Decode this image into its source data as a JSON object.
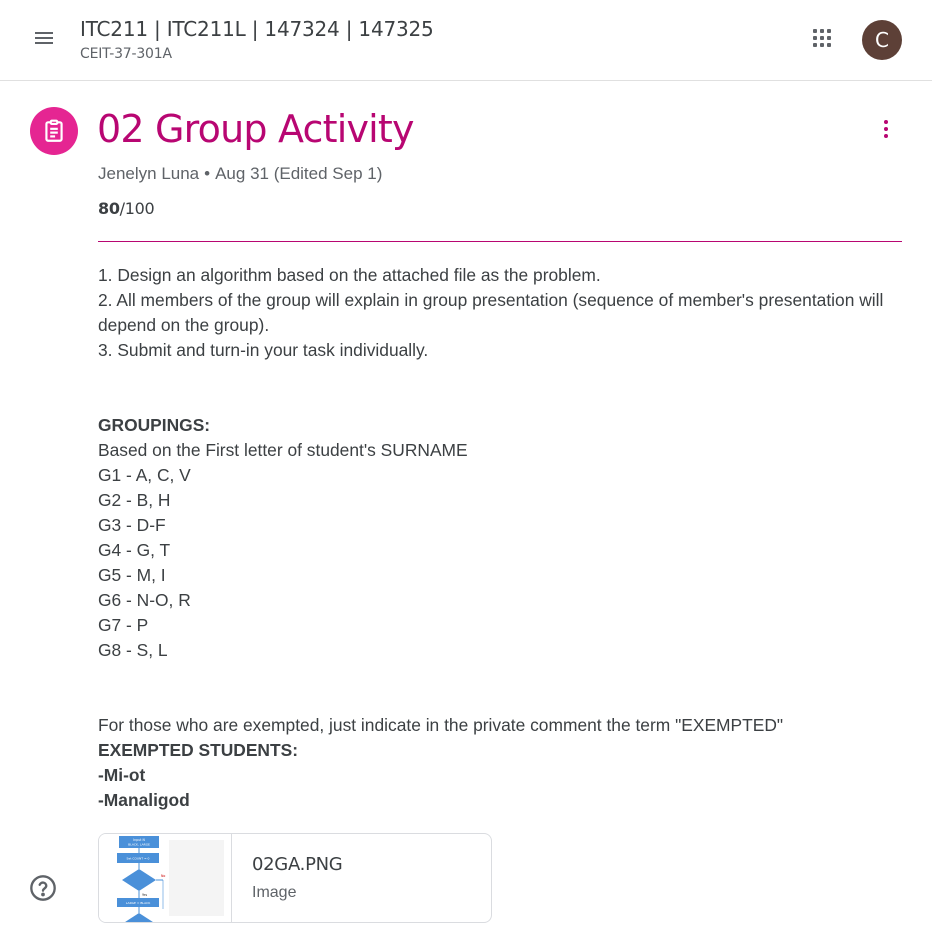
{
  "header": {
    "course_title": "ITC211 | ITC211L | 147324 | 147325",
    "course_section": "CEIT-37-301A",
    "avatar_letter": "C",
    "avatar_color": "#5d4037",
    "icons": {
      "menu": "hamburger-menu-icon",
      "apps": "apps-grid-icon"
    }
  },
  "assignment": {
    "title": "02 Group Activity",
    "author": "Jenelyn Luna",
    "separator": "•",
    "date": "Aug 31 (Edited Sep 1)",
    "score": "80",
    "total": "/100",
    "accent_color": "#b80672",
    "icon_color": "#e52592",
    "icons": {
      "type": "assignment-clipboard-icon",
      "more": "more-vert-icon"
    }
  },
  "instructions": {
    "step1": "1. Design an algorithm based on the attached file as the problem.",
    "step2": "2. All members of the group will explain in group presentation (sequence of member's presentation will depend on the group).",
    "step3": "3. Submit and turn-in your task individually.",
    "groupings_heading": "GROUPINGS:",
    "groupings_note": "Based on the First letter of student's SURNAME",
    "groups": [
      "G1 - A, C, V",
      "G2 - B, H",
      "G3 - D-F",
      "G4 - G, T",
      "G5 - M, I",
      "G6 - N-O, R",
      "G7 - P",
      "G8 - S, L"
    ],
    "exempt_note": "For those who are exempted, just indicate in the private comment the term \"EXEMPTED\"",
    "exempted_heading": "EXEMPTED STUDENTS:",
    "exempted": [
      "-Mi-ot",
      "-Manaligod"
    ]
  },
  "attachment": {
    "name": "02GA.PNG",
    "type": "Image",
    "thumbnail_icon": "flowchart-thumbnail-image",
    "thumb_text": [
      "Input N",
      "BLACK, LARGE",
      "Set COUNT = 0",
      "No",
      "Yes",
      "LARGE = BLACK"
    ]
  },
  "help": {
    "icon": "help-circle-icon"
  }
}
